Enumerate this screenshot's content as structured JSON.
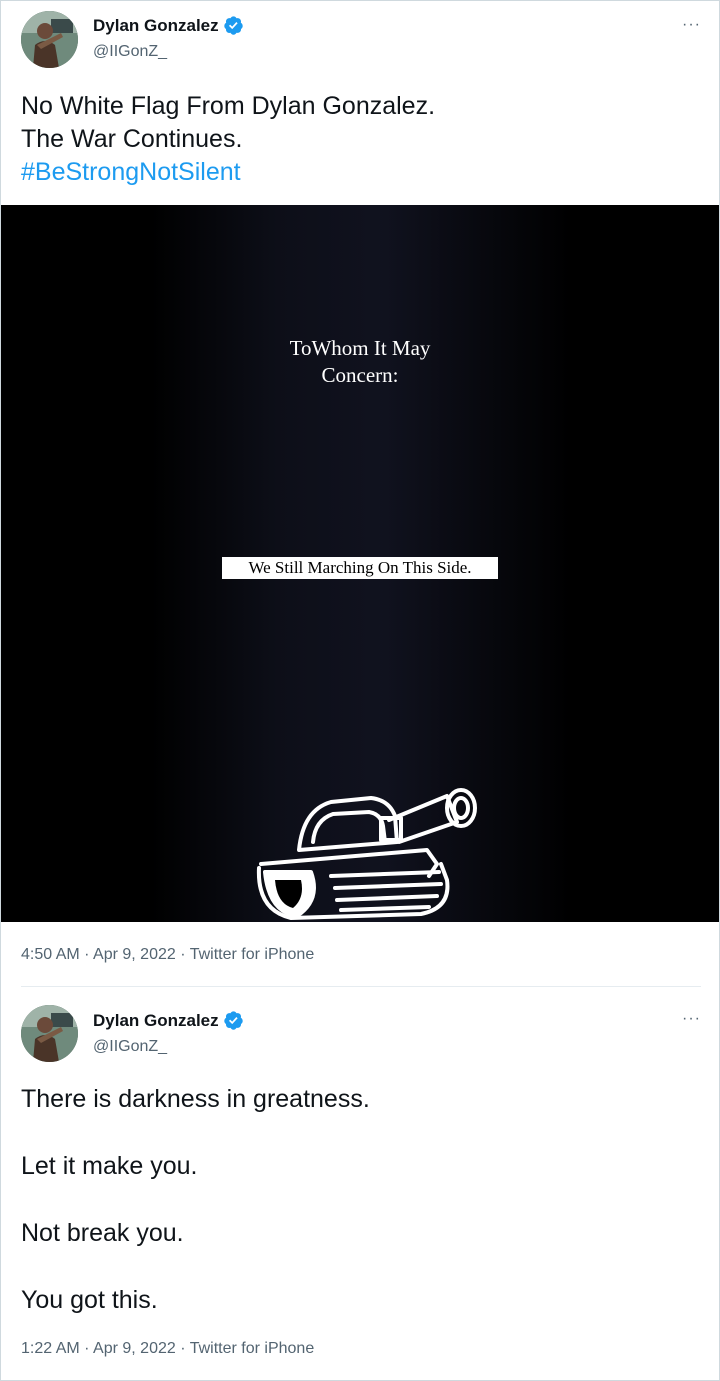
{
  "tweets": [
    {
      "author": {
        "name": "Dylan Gonzalez",
        "handle": "@IIGonZ_",
        "verified": true
      },
      "text_lines": [
        "No White Flag From Dylan Gonzalez.",
        "The War Continues."
      ],
      "hashtag": "#BeStrongNotSilent",
      "media": {
        "letter_line1": "ToWhom It May",
        "letter_line2": "Concern:",
        "banner_text": "We Still Marching On This Side.",
        "illustration": "tank-drawing"
      },
      "time": "4:50 AM",
      "date": "Apr 9, 2022",
      "source": "Twitter for iPhone",
      "more_label": "···"
    },
    {
      "author": {
        "name": "Dylan Gonzalez",
        "handle": "@IIGonZ_",
        "verified": true
      },
      "text_lines": [
        "There is darkness in greatness.",
        "Let it make you.",
        "Not break you.",
        "You got this."
      ],
      "time": "1:22 AM",
      "date": "Apr 9, 2022",
      "source": "Twitter for iPhone",
      "more_label": "···"
    }
  ],
  "separator": " · ",
  "colors": {
    "accent": "#1d9bf0",
    "secondary_text": "#536471",
    "primary_text": "#0f1419",
    "media_bg": "#000000"
  }
}
